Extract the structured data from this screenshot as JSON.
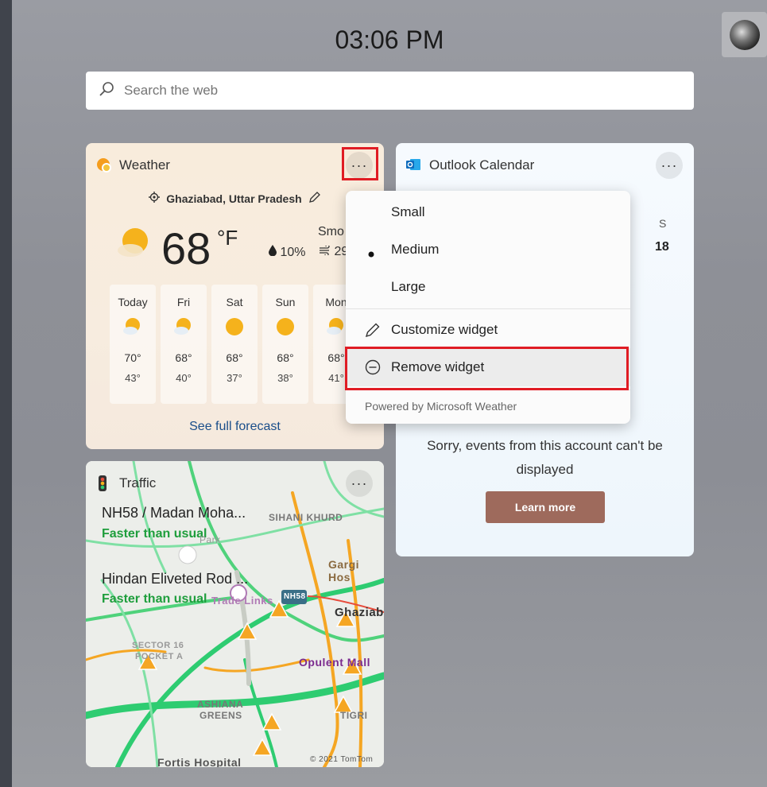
{
  "clock": "03:06 PM",
  "search": {
    "placeholder": "Search the web"
  },
  "weather": {
    "title": "Weather",
    "location": "Ghaziabad, Uttar Pradesh",
    "temperature": "68",
    "unit": "°F",
    "precipitation": "10%",
    "condition": "Smo",
    "wind": "29",
    "forecast": [
      {
        "day": "Today",
        "high": "70°",
        "low": "43°",
        "icon": "partly-sunny-icon"
      },
      {
        "day": "Fri",
        "high": "68°",
        "low": "40°",
        "icon": "partly-sunny-icon"
      },
      {
        "day": "Sat",
        "high": "68°",
        "low": "37°",
        "icon": "sunny-icon"
      },
      {
        "day": "Sun",
        "high": "68°",
        "low": "38°",
        "icon": "sunny-icon"
      },
      {
        "day": "Mon",
        "high": "68°",
        "low": "41°",
        "icon": "partly-sunny-icon"
      }
    ],
    "see_full": "See full forecast"
  },
  "traffic": {
    "title": "Traffic",
    "routes": [
      {
        "name": "NH58 / Madan Moha...",
        "status": "Faster than usual"
      },
      {
        "name": "Hindan Eliveted Rod ...",
        "status": "Faster than usual"
      }
    ],
    "map_labels": {
      "sihani": "SIHANI KHURD",
      "gargi": "Gargi Hos",
      "ghaziab": "Ghaziab",
      "trade": "Trade Links",
      "nh58": "NH58",
      "sector16": "SECTOR 16",
      "pocketa": "POCKET A",
      "opulent": "Opulent Mall",
      "ashiana": "ASHIANA",
      "greens": "GREENS",
      "tigri": "TIGRI",
      "fortis": "Fortis Hospital",
      "park": "Park",
      "copyright": "© 2021 TomTom"
    }
  },
  "calendar": {
    "title": "Outlook Calendar",
    "day_letter": "S",
    "date": "18",
    "sorry": "Sorry, events from this account can't be displayed",
    "learn_more": "Learn more"
  },
  "menu": {
    "small": "Small",
    "medium": "Medium",
    "large": "Large",
    "customize": "Customize widget",
    "remove": "Remove widget",
    "powered": "Powered by Microsoft Weather"
  },
  "colors": {
    "accent_red": "#e01c24",
    "learn_more_bg": "#9e6a5c",
    "traffic_green": "#1e9e3c"
  }
}
